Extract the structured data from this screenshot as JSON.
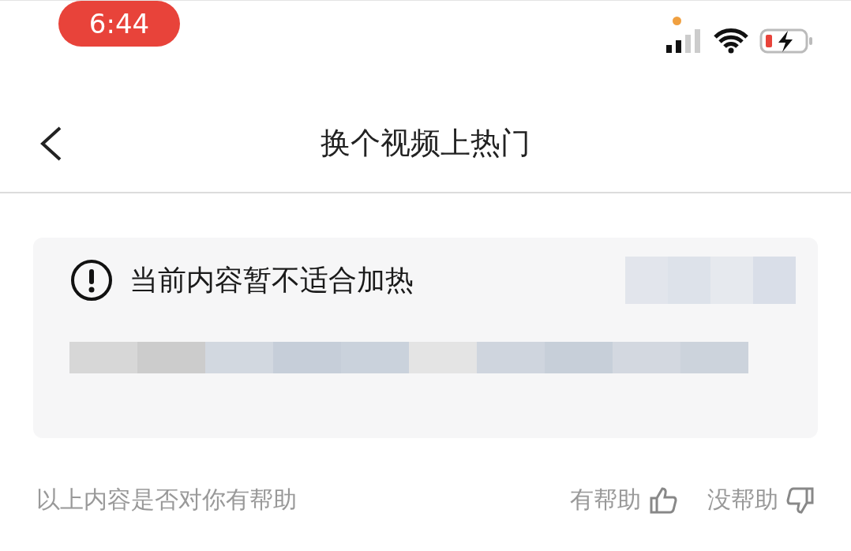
{
  "status_bar": {
    "time": "6:44"
  },
  "nav": {
    "title": "换个视频上热门"
  },
  "notice": {
    "title": "当前内容暂不适合加热"
  },
  "feedback": {
    "prompt": "以上内容是否对你有帮助",
    "options": [
      {
        "label": "有帮助",
        "kind": "up"
      },
      {
        "label": "没帮助",
        "kind": "down"
      }
    ]
  }
}
